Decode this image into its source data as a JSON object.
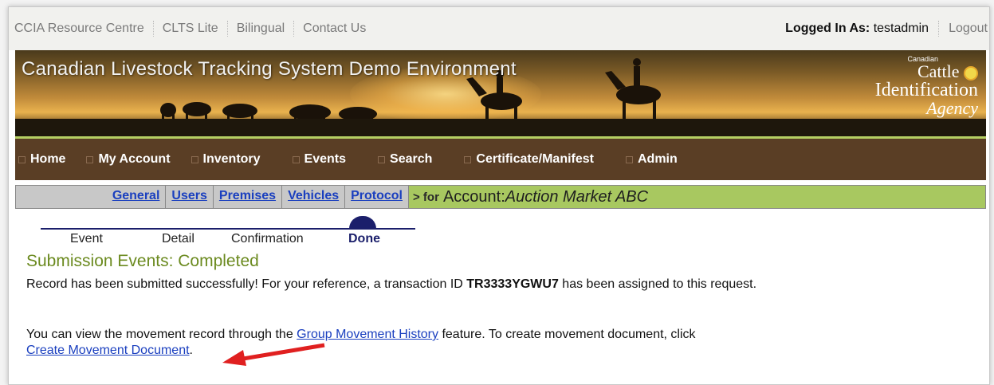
{
  "top_links": [
    "CCIA Resource Centre",
    "CLTS Lite",
    "Bilingual",
    "Contact Us"
  ],
  "login": {
    "label": "Logged In As:",
    "user": "testadmin"
  },
  "logout_label": "Logout",
  "banner": {
    "title": "Canadian Livestock Tracking System Demo Environment",
    "logo": {
      "small": "Canadian",
      "line1": "Cattle",
      "line2": "Identification",
      "line3": "Agency"
    }
  },
  "main_nav": [
    "Home",
    "My Account",
    "Inventory",
    "Events",
    "Search",
    "Certificate/Manifest",
    "Admin"
  ],
  "sub_nav": {
    "tabs": [
      "General",
      "Users",
      "Premises",
      "Vehicles",
      "Protocol"
    ],
    "for_label": "> for",
    "account_label": "Account:",
    "account_name": "Auction Market ABC"
  },
  "steps": [
    "Event",
    "Detail",
    "Confirmation",
    "Done"
  ],
  "section_title": "Submission Events: Completed",
  "message": {
    "p1_before": "Record has been submitted successfully! For your reference, a transaction ID ",
    "transaction_id": "TR3333YGWU7",
    "p1_after": " has been assigned to this request.",
    "p2_before": "You can view the movement record through the ",
    "group_link": "Group Movement History",
    "p2_middle": " feature. To create movement document, click ",
    "create_link": "Create Movement Document",
    "p2_end": "."
  },
  "colors": {
    "nav_bg": "#5a3e25",
    "subnav_green": "#a8c860",
    "title_green": "#6b8a1f",
    "link": "#1a3fbf",
    "arrow": "#e02020"
  }
}
